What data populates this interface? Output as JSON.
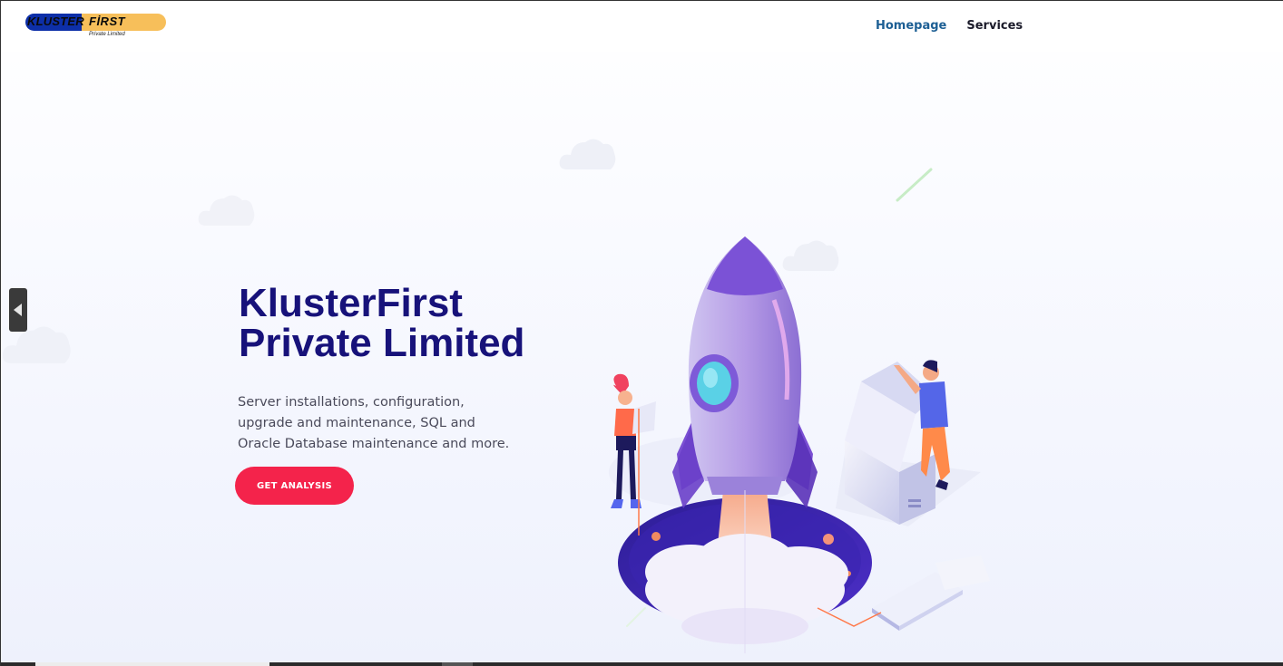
{
  "logo": {
    "word_left": "KLUSTER",
    "word_right": "FİRST",
    "tagline": "Private Limited",
    "colors": {
      "blue": "#0d2fa8",
      "yellow": "#f7bf5a"
    }
  },
  "nav": {
    "items": [
      {
        "label": "Homepage",
        "active": true
      },
      {
        "label": "Services",
        "active": false
      }
    ]
  },
  "hero": {
    "title_line1": "KlusterFirst",
    "title_line2": "Private Limited",
    "description": "Server installations, configuration, upgrade and maintenance, SQL and Oracle Database maintenance and more.",
    "cta_label": "GET ANALYSIS",
    "colors": {
      "title": "#17127a",
      "cta": "#f4234b"
    }
  },
  "side_handle": {
    "icon": "chevron-left-icon"
  },
  "illustration": {
    "subject": "rocket-launch-illustration"
  }
}
